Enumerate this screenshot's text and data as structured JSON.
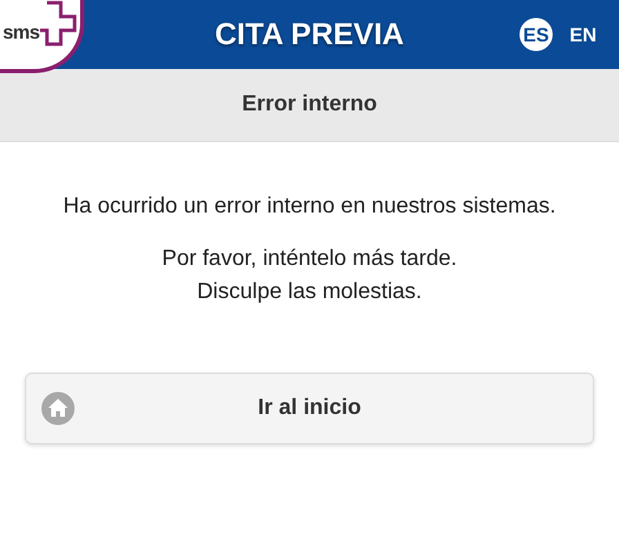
{
  "header": {
    "logo_text": "sms",
    "title": "CITA PREVIA",
    "languages": [
      {
        "label": "ES",
        "selected": true
      },
      {
        "label": "EN",
        "selected": false
      }
    ]
  },
  "page_title": "Error interno",
  "message": "Ha ocurrido un error interno en nuestros sistemas.",
  "details": [
    "Por favor, inténtelo más tarde.",
    "Disculpe las molestias."
  ],
  "home_button": {
    "label": "Ir al inicio"
  }
}
